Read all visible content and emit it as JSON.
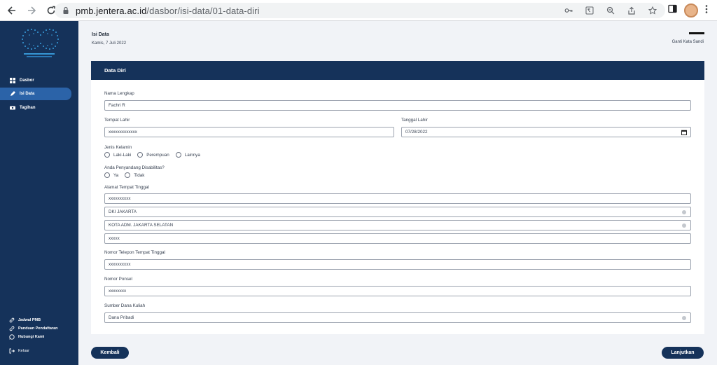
{
  "browser": {
    "url_host": "pmb.jentera.ac.id",
    "url_path": "/dasbor/isi-data/01-data-diri"
  },
  "sidebar": {
    "menu": [
      {
        "label": "Dasbor",
        "icon": "grid-icon"
      },
      {
        "label": "Isi Data",
        "icon": "pen-icon",
        "active": true
      },
      {
        "label": "Tagihan",
        "icon": "bill-icon"
      }
    ],
    "footer": [
      {
        "label": "Jadwal PMB",
        "icon": "link-icon"
      },
      {
        "label": "Panduan Pendaftaran",
        "icon": "link-icon"
      },
      {
        "label": "Hubungi Kami",
        "icon": "whatsapp-icon"
      }
    ],
    "logout": "Keluar"
  },
  "header": {
    "title": "Isi Data",
    "date": "Kamis, 7 Juli 2022",
    "user_link": "Ganti Kata Sandi"
  },
  "form": {
    "card_title": "Data Diri",
    "nama_label": "Nama Lengkap",
    "nama_value": "Fachri R",
    "tempat_lahir_label": "Tempat Lahir",
    "tempat_lahir_value": "xxxxxxxxxxxxx",
    "tanggal_lahir_label": "Tanggal Lahir",
    "tanggal_lahir_value": "07/28/2022",
    "jenis_kelamin_label": "Jenis Kelamin",
    "jenis_kelamin_options": [
      "Laki-Laki",
      "Perempuan",
      "Lainnya"
    ],
    "disabilitas_label": "Anda Penyandang Disabilitas?",
    "disabilitas_options": [
      "Ya",
      "Tidak"
    ],
    "alamat_label": "Alamat Tempat Tinggal",
    "alamat_jalan": "xxxxxxxxxx",
    "alamat_provinsi": "DKI JAKARTA",
    "alamat_kota": "KOTA ADM. JAKARTA SELATAN",
    "alamat_kodepos": "xxxxx",
    "telepon_label": "Nomor Telepon Tempat Tinggal",
    "telepon_value": "xxxxxxxxxx",
    "ponsel_label": "Nomor Ponsel",
    "ponsel_value": "xxxxxxxx",
    "sumber_dana_label": "Sumber Dana Kuliah",
    "sumber_dana_value": "Dana Pribadi"
  },
  "buttons": {
    "back": "Kembali",
    "next": "Lanjutkan"
  },
  "colors": {
    "navy": "#15325a",
    "active": "#2b63a8"
  }
}
